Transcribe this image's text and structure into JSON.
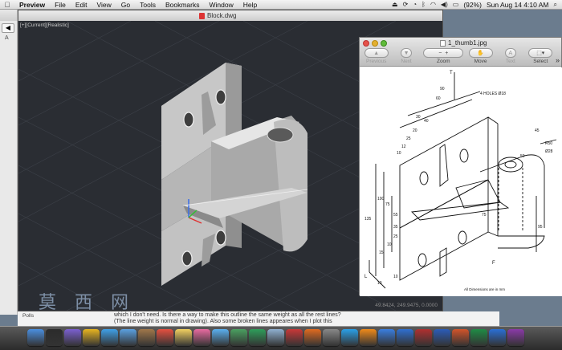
{
  "menubar": {
    "apple": "",
    "app_name": "Preview",
    "menus": [
      "File",
      "Edit",
      "View",
      "Go",
      "Tools",
      "Bookmarks",
      "Window",
      "Help"
    ],
    "battery": "(92%)",
    "datetime": "Sun Aug 14  4:10 AM"
  },
  "background_window": {
    "nav_back": "◀",
    "letter": "A"
  },
  "cad_window": {
    "title": "Block.dwg",
    "viewport_label": "[+][Current][Realistic]",
    "coords": "49.8424, 249.9475, 0.0000"
  },
  "preview_window": {
    "title": "1_thumb1.jpg",
    "toolbar": {
      "previous": "Previous",
      "next": "Next",
      "zoom": "Zoom",
      "move": "Move",
      "text": "Text",
      "select": "Select"
    },
    "drawing": {
      "holes_note": "4 HOLES Ø18",
      "footer": "All Dimensions are in mm",
      "dims": [
        "90",
        "60",
        "30",
        "40",
        "20",
        "25",
        "12",
        "10",
        "45",
        "R50",
        "Ø28",
        "135",
        "100",
        "75",
        "55",
        "35",
        "25",
        "10",
        "15",
        "75",
        "95",
        "50",
        "10",
        "10"
      ],
      "axis_t": "T",
      "axis_l": "L",
      "axis_f": "F"
    }
  },
  "forum": {
    "watermark": "莫 西 网",
    "poll_label": "Polls",
    "line1": "which I don't need. Is there a way to make this outline the same weight as all the rest lines?",
    "line2": "(The line weight is normal in drawing). Also some broken lines appeares when I plot this"
  },
  "colors": {
    "cad_bg": "#2a2d33",
    "model_light": "#d8d8d8",
    "model_mid": "#b4b4b4",
    "model_dark": "#8c8c8c",
    "ucs_x": "#e03030",
    "ucs_y": "#30c030",
    "ucs_z": "#3a6ee8"
  },
  "dock": {
    "icons": [
      "finder-icon",
      "dashboard-icon",
      "mission-control-icon",
      "chrome-icon",
      "safari-icon",
      "mail-icon",
      "contacts-icon",
      "calendar-icon",
      "notes-icon",
      "photos-icon",
      "itunes-icon",
      "iphoto-icon",
      "facetime-icon",
      "preview-icon",
      "autocad-icon",
      "firefox-icon",
      "system-prefs-icon",
      "skype-icon",
      "vlc-icon",
      "app-store-icon",
      "dropbox-icon",
      "filezilla-icon",
      "word-icon",
      "powerpoint-icon",
      "excel-icon",
      "outlook-icon",
      "onenote-icon"
    ]
  }
}
